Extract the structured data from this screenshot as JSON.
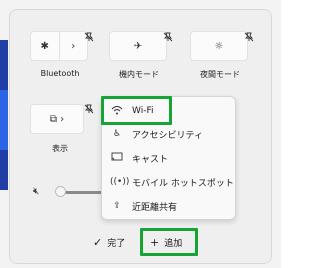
{
  "tiles": [
    {
      "label": "Bluetooth"
    },
    {
      "label": "機内モード"
    },
    {
      "label": "夜間モード"
    },
    {
      "label": "表示"
    }
  ],
  "menu": {
    "items": [
      {
        "label": "Wi-Fi",
        "icon": "wifi-icon"
      },
      {
        "label": "アクセシビリティ",
        "icon": "accessibility-icon"
      },
      {
        "label": "キャスト",
        "icon": "cast-icon"
      },
      {
        "label": "モバイル ホットスポット",
        "icon": "hotspot-icon"
      },
      {
        "label": "近距離共有",
        "icon": "nearby-share-icon"
      }
    ]
  },
  "footer": {
    "done_label": "完了",
    "add_label": "追加"
  },
  "colors": {
    "highlight": "#16a534",
    "panel_bg": "#efefef"
  }
}
